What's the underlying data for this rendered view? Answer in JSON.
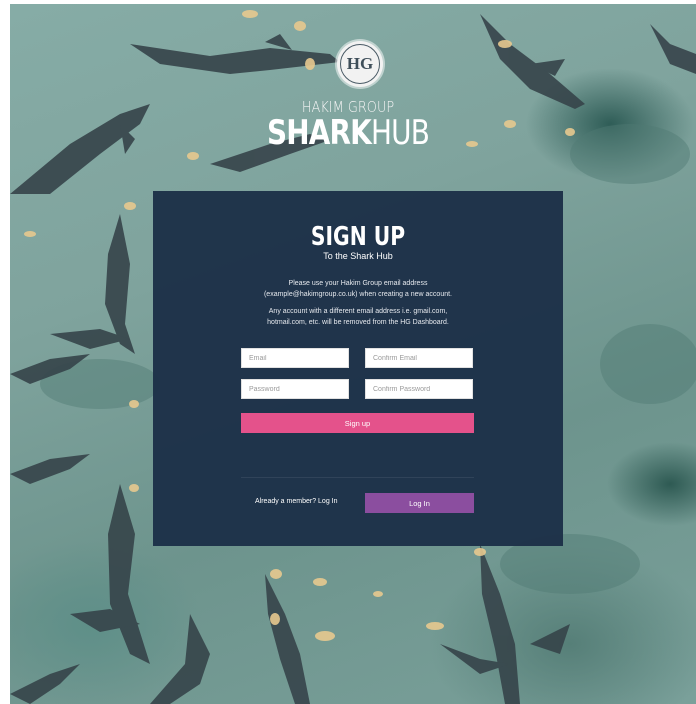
{
  "brand": {
    "logo_initials": "HG",
    "top_line": "HAKIM GROUP",
    "main_bold": "SHARK",
    "main_light": "HUB"
  },
  "signup": {
    "title": "SIGN UP",
    "subtitle": "To the Shark Hub",
    "paragraph1": "Please use your Hakim Group email address (example@hakimgroup.co.uk) when creating a new account.",
    "paragraph2": "Any account with a different email address i.e. gmail.com, hotmail.com, etc. will be removed from the HG Dashboard.",
    "fields": {
      "email_placeholder": "Email",
      "confirm_email_placeholder": "Confirm Email",
      "password_placeholder": "Password",
      "confirm_password_placeholder": "Confirm Password"
    },
    "signup_button": "Sign up",
    "member_text": "Already a member? Log In",
    "login_button": "Log In"
  },
  "colors": {
    "card_bg": "#1c3048",
    "signup_button": "#e4528b",
    "login_button": "#8b4e9f",
    "water": "#7fa39d"
  },
  "icons": {
    "logo": "hg-logo-icon"
  }
}
